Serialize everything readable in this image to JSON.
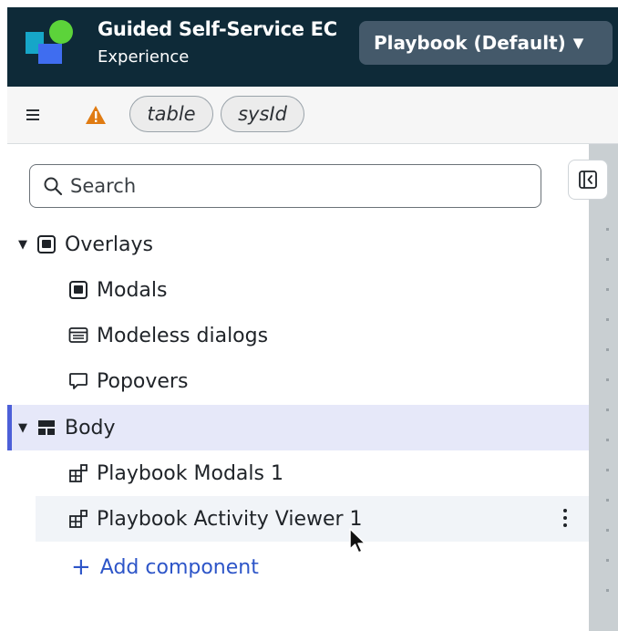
{
  "header": {
    "app_title": "Guided Self-Service EC",
    "app_subtitle": "Experience",
    "variant_label": "Playbook (Default)"
  },
  "toolbar": {
    "chips": [
      "table",
      "sysId"
    ]
  },
  "search": {
    "placeholder": "Search"
  },
  "tree": {
    "overlays_label": "Overlays",
    "modals_label": "Modals",
    "modeless_label": "Modeless dialogs",
    "popovers_label": "Popovers",
    "body_label": "Body",
    "item1_label": "Playbook Modals 1",
    "item2_label": "Playbook Activity Viewer 1",
    "add_label": "Add component"
  },
  "colors": {
    "header_bg": "#0e2a38",
    "accent": "#4c5fd8",
    "link": "#2d55c8",
    "warning": "#e07b12"
  }
}
